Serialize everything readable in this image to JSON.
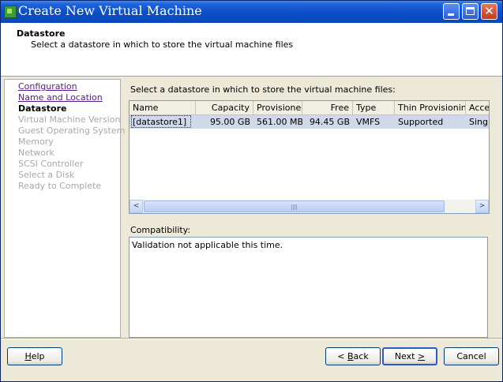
{
  "window": {
    "title": "Create New Virtual Machine",
    "controls": [
      "minimize",
      "maximize",
      "close"
    ],
    "close_glyph": "✕"
  },
  "header": {
    "title": "Datastore",
    "subtitle": "Select a datastore in which to store the virtual machine files"
  },
  "sidebar": {
    "items": [
      {
        "label": "Configuration",
        "state": "link"
      },
      {
        "label": "Name and Location",
        "state": "link"
      },
      {
        "label": "Datastore",
        "state": "active"
      },
      {
        "label": "Virtual Machine Version",
        "state": "disabled"
      },
      {
        "label": "Guest Operating System",
        "state": "disabled"
      },
      {
        "label": "Memory",
        "state": "disabled"
      },
      {
        "label": "Network",
        "state": "disabled"
      },
      {
        "label": "SCSI Controller",
        "state": "disabled"
      },
      {
        "label": "Select a Disk",
        "state": "disabled"
      },
      {
        "label": "Ready to Complete",
        "state": "disabled"
      }
    ]
  },
  "main": {
    "prompt": "Select a datastore in which to store the virtual machine files:",
    "table": {
      "columns": [
        "Name",
        "Capacity",
        "Provisioned",
        "Free",
        "Type",
        "Thin Provisioning",
        "Acces"
      ],
      "rows": [
        {
          "name": "[datastore1]",
          "capacity": "95.00 GB",
          "provisioned": "561.00 MB",
          "free": "94.45 GB",
          "type": "VMFS",
          "thin": "Supported",
          "access": "Single"
        }
      ]
    },
    "scrollbar": {
      "left_arrow": "<",
      "right_arrow": ">"
    },
    "compatibility_label": "Compatibility:",
    "compatibility_text": "Validation not applicable this time."
  },
  "footer": {
    "help": {
      "prefix": "",
      "key": "H",
      "suffix": "elp"
    },
    "back": {
      "prefix": "< ",
      "key": "B",
      "suffix": "ack"
    },
    "next": {
      "prefix": "Next ",
      "key": ">",
      "suffix": ""
    },
    "cancel": "Cancel"
  },
  "colors": {
    "title_bar": "#0a4ec8",
    "selected_row": "#cfd9ea",
    "link": "#551a8b",
    "disabled_text": "#a8a8a8"
  }
}
